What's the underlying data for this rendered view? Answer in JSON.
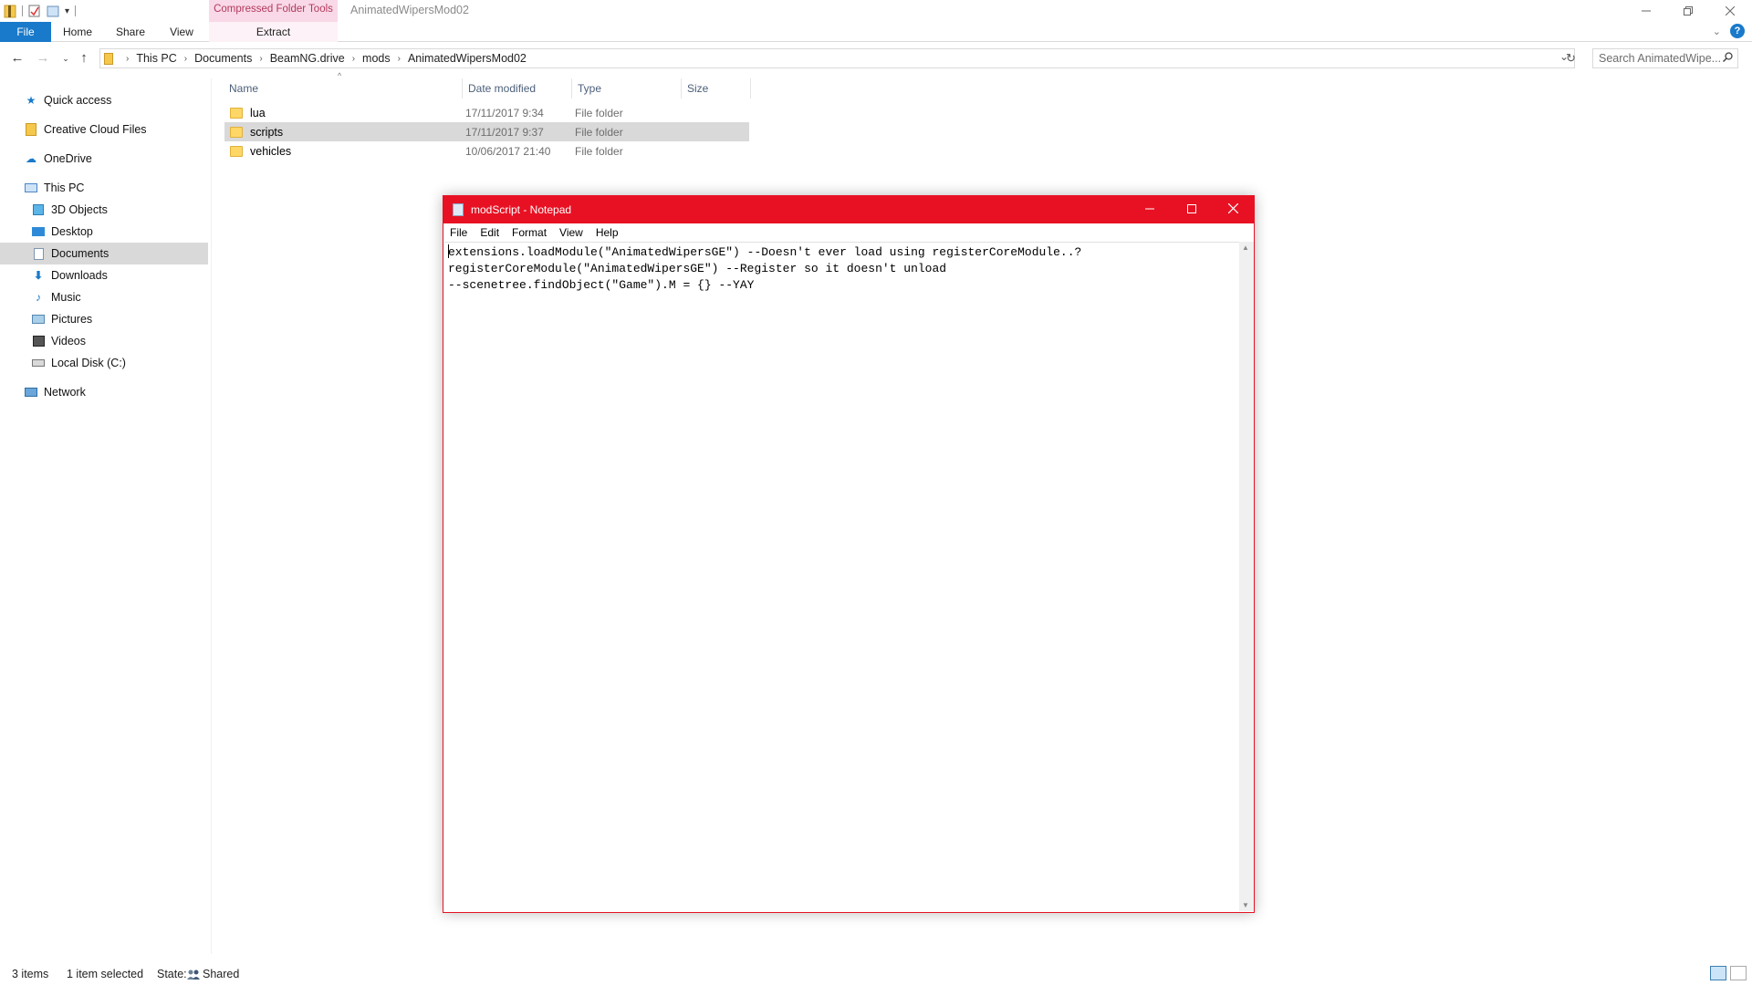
{
  "window": {
    "title": "AnimatedWipersMod02",
    "context_tab_group": "Compressed Folder Tools"
  },
  "ribbon": {
    "tabs": [
      "File",
      "Home",
      "Share",
      "View"
    ],
    "context_tab": "Extract"
  },
  "address": {
    "breadcrumbs": [
      "This PC",
      "Documents",
      "BeamNG.drive",
      "mods",
      "AnimatedWipersMod02"
    ],
    "search_placeholder": "Search AnimatedWipe..."
  },
  "nav": {
    "quick_access": "Quick access",
    "creative_cloud": "Creative Cloud Files",
    "onedrive": "OneDrive",
    "this_pc": "This PC",
    "objects3d": "3D Objects",
    "desktop": "Desktop",
    "documents": "Documents",
    "downloads": "Downloads",
    "music": "Music",
    "pictures": "Pictures",
    "videos": "Videos",
    "local_disk": "Local Disk (C:)",
    "network": "Network",
    "selected": "Documents"
  },
  "file_list": {
    "columns": {
      "name": "Name",
      "date": "Date modified",
      "type": "Type",
      "size": "Size"
    },
    "rows": [
      {
        "name": "lua",
        "date": "17/11/2017 9:34",
        "type": "File folder",
        "size": ""
      },
      {
        "name": "scripts",
        "date": "17/11/2017 9:37",
        "type": "File folder",
        "size": ""
      },
      {
        "name": "vehicles",
        "date": "10/06/2017 21:40",
        "type": "File folder",
        "size": ""
      }
    ],
    "selected_row": "scripts"
  },
  "status": {
    "items": "3 items",
    "selected": "1 item selected",
    "state_label": "State:",
    "state_value": "Shared"
  },
  "notepad": {
    "title": "modScript - Notepad",
    "menu": [
      "File",
      "Edit",
      "Format",
      "View",
      "Help"
    ],
    "lines": [
      "extensions.loadModule(\"AnimatedWipersGE\") --Doesn't ever load using registerCoreModule..?",
      "registerCoreModule(\"AnimatedWipersGE\") --Register so it doesn't unload",
      "--scenetree.findObject(\"Game\").M = {} --YAY"
    ]
  },
  "colors": {
    "notepad_accent": "#e81123",
    "file_tab": "#1979ca",
    "context_tab": "#f9d9e7",
    "selection": "#d9d9d9"
  }
}
